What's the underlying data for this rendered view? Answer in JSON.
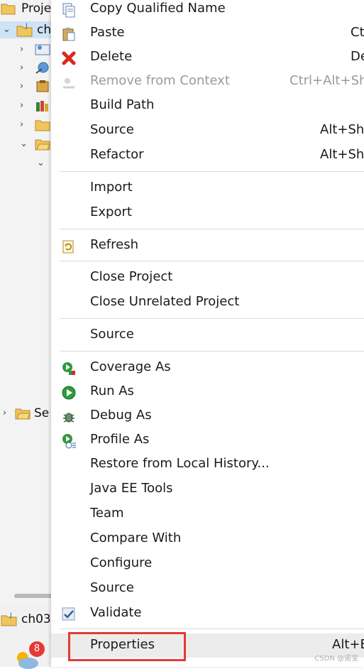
{
  "explorer": {
    "title": "Proje",
    "project_label": "ch",
    "servers_label": "Se",
    "bottom_label": "ch03",
    "notification_count": "8"
  },
  "menu": {
    "items": [
      {
        "label": "Copy Qualified Name",
        "accel": "",
        "icon": "copy-qualified-name-icon"
      },
      {
        "label": "Paste",
        "accel": "Ct",
        "icon": "paste-clipboard-icon"
      },
      {
        "label": "Delete",
        "accel": "De",
        "icon": "red-x-delete-icon"
      },
      {
        "label": "Remove from Context",
        "accel": "Ctrl+Alt+Shi",
        "icon": "remove-from-context-icon",
        "disabled": true
      },
      {
        "label": "Build Path",
        "accel": ""
      },
      {
        "label": "Source",
        "accel": "Alt+Shi"
      },
      {
        "label": "Refactor",
        "accel": "Alt+Shi"
      },
      {
        "label": "Import",
        "accel": ""
      },
      {
        "label": "Export",
        "accel": ""
      },
      {
        "label": "Refresh",
        "accel": "",
        "icon": "refresh-icon"
      },
      {
        "label": "Close Project",
        "accel": ""
      },
      {
        "label": "Close Unrelated Project",
        "accel": ""
      },
      {
        "label": "Source",
        "accel": ""
      },
      {
        "label": "Coverage As",
        "accel": "",
        "icon": "coverage-icon"
      },
      {
        "label": "Run As",
        "accel": "",
        "icon": "run-icon"
      },
      {
        "label": "Debug As",
        "accel": "",
        "icon": "debug-bug-icon"
      },
      {
        "label": "Profile As",
        "accel": "",
        "icon": "profile-icon"
      },
      {
        "label": "Restore from Local History...",
        "accel": ""
      },
      {
        "label": "Java EE Tools",
        "accel": ""
      },
      {
        "label": "Team",
        "accel": ""
      },
      {
        "label": "Compare With",
        "accel": ""
      },
      {
        "label": "Configure",
        "accel": ""
      },
      {
        "label": "Source",
        "accel": ""
      },
      {
        "label": "Validate",
        "accel": "",
        "icon": "checkbox-checked-icon"
      },
      {
        "label": "Properties",
        "accel": "Alt+E"
      }
    ]
  },
  "watermark": "CSDN @诺宝",
  "colors": {
    "highlight_border": "#e53935",
    "selection": "#cfe3f7",
    "disabled_text": "#9a9a9a"
  }
}
